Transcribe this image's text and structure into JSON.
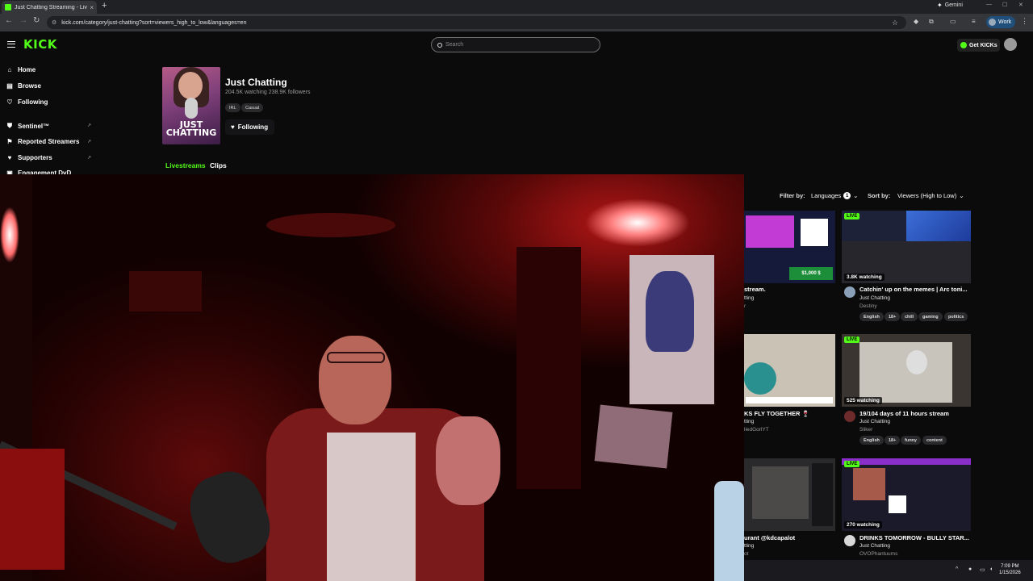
{
  "browser": {
    "tab_title": "Just Chatting Streaming - Live",
    "tab_close": "×",
    "new_tab": "+",
    "url": "kick.com/category/just-chatting?sort=viewers_high_to_low&languages=en",
    "gemini_label": "Gemini",
    "profile_label": "Work"
  },
  "header": {
    "logo": "KICK",
    "search_placeholder": "Search",
    "get_kicks_label": "Get KICKs"
  },
  "sidebar": {
    "items": [
      {
        "label": "Home",
        "icon": "home-icon"
      },
      {
        "label": "Browse",
        "icon": "browse-icon"
      },
      {
        "label": "Following",
        "icon": "heart-icon"
      },
      {
        "label": "Sentinel™",
        "icon": "shield-icon"
      },
      {
        "label": "Reported Streamers",
        "icon": "flag-icon"
      },
      {
        "label": "Supporters",
        "icon": "heart-icon"
      },
      {
        "label": "Engagement DvD",
        "icon": "cube-icon"
      }
    ]
  },
  "category": {
    "cover_text_line1": "JUST",
    "cover_text_line2": "CHATTING",
    "title": "Just Chatting",
    "stats": "204.5K watching   238.9K followers",
    "tags": [
      "IRL",
      "Casual"
    ],
    "follow_label": "Following",
    "tabs": [
      "Livestreams",
      "Clips"
    ]
  },
  "filters": {
    "filter_by_label": "Filter by:",
    "languages_label": "Languages",
    "languages_count": "1",
    "sort_by_label": "Sort by:",
    "sort_value": "Viewers (High to Low)"
  },
  "cards": [
    {
      "title": "stream.",
      "category": "tting",
      "user": "r",
      "viewers": "",
      "live": false,
      "tags": []
    },
    {
      "title": "Catchin' up on the memes | Arc toni...",
      "category": "Just Chatting",
      "user": "Destiny",
      "viewers": "3.8K watching",
      "live": true,
      "tags": [
        "English",
        "18+",
        "chill",
        "gaming",
        "politics"
      ]
    },
    {
      "title": "KS FLY TOGETHER 🍷",
      "category": "tting",
      "user": "liedGorlYT",
      "viewers": "",
      "live": false,
      "tags": []
    },
    {
      "title": "19/104 days of 11 hours stream",
      "category": "Just Chatting",
      "user": "Sliker",
      "viewers": "525 watching",
      "live": true,
      "tags": [
        "English",
        "18+",
        "funny",
        "content"
      ]
    },
    {
      "title": "urant @kdcapalot",
      "category": "tting",
      "user": "ot",
      "viewers": "",
      "live": false,
      "tags": []
    },
    {
      "title": "DRINKS TOMORROW - BULLY STAR...",
      "category": "Just Chatting",
      "user": "OVOPhantuums",
      "viewers": "270 watching",
      "live": true,
      "tags": []
    }
  ],
  "live_badge": "LIVE",
  "thumb_texts": {
    "card1_price": "$1,000 $"
  },
  "taskbar": {
    "time": "7:09 PM",
    "date": "1/15/2026"
  },
  "colors": {
    "brand": "#53fc18",
    "background": "#0b0b0c"
  }
}
